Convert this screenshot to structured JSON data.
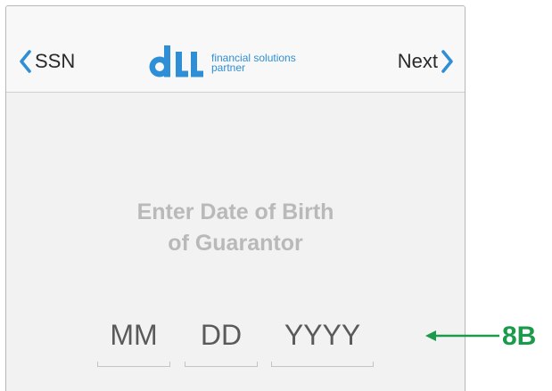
{
  "navbar": {
    "back_label": "SSN",
    "next_label": "Next",
    "back_icon": "chevron-left-icon",
    "next_icon": "chevron-right-icon"
  },
  "logo": {
    "mark": "dLL",
    "tagline_line1": "financial solutions",
    "tagline_line2": "partner"
  },
  "prompt": {
    "line1": "Enter Date of Birth",
    "line2": "of Guarantor"
  },
  "dob_fields": {
    "month_placeholder": "MM",
    "day_placeholder": "DD",
    "year_placeholder": "YYYY"
  },
  "annotation": {
    "label": "8B",
    "arrow_icon": "arrow-left-icon"
  },
  "colors": {
    "accent_blue": "#2f8fd6",
    "annotation_green": "#1a9a4a",
    "prompt_gray": "#b9b9b9",
    "background": "#f2f2f2"
  }
}
